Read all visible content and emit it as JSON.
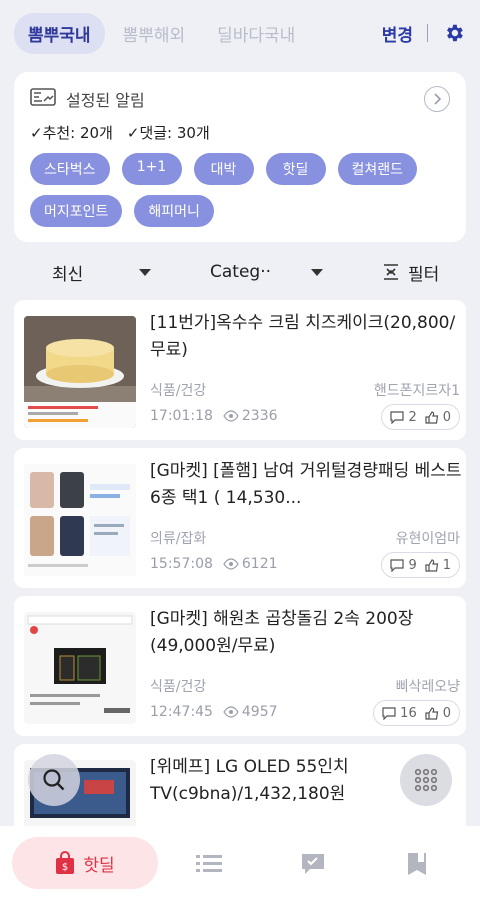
{
  "topbar": {
    "tabs": [
      {
        "label": "뽐뿌국내"
      },
      {
        "label": "뽐뿌해외"
      },
      {
        "label": "딜바다국내"
      }
    ],
    "change_label": "변경"
  },
  "alerts": {
    "title": "설정된 알림",
    "recommend": "✓추천: 20개",
    "comments": "✓댓글: 30개",
    "keywords": [
      "스타벅스",
      "1+1",
      "대박",
      "핫딜",
      "컬쳐랜드",
      "머지포인트",
      "해피머니"
    ]
  },
  "filters": {
    "sort": "최신",
    "category": "Categ··",
    "filter_label": "필터"
  },
  "deals": [
    {
      "title": "[11번가]옥수수 크림 치즈케이크(20,800/무료)",
      "category": "식품/건강",
      "author": "핸드폰지르자1",
      "time": "17:01:18",
      "views": "2336",
      "comments": "2",
      "likes": "0"
    },
    {
      "title": "[G마켓] [폴햄] 남여 거위털경량패딩 베스트 6종 택1 ( 14,530...",
      "category": "의류/잡화",
      "author": "유현이엄마",
      "time": "15:57:08",
      "views": "6121",
      "comments": "9",
      "likes": "1"
    },
    {
      "title": "[G마켓] 해원초 곱창돌김 2속 200장 (49,000원/무료)",
      "category": "식품/건강",
      "author": "삐삭레오냥",
      "time": "12:47:45",
      "views": "4957",
      "comments": "16",
      "likes": "0"
    },
    {
      "title": "[위메프] LG OLED 55인치 TV(c9bna)/1,432,180원",
      "category": "",
      "author": "",
      "time": "",
      "views": "",
      "comments": "",
      "likes": ""
    }
  ],
  "bottomnav": {
    "active_label": "핫딜"
  },
  "colors": {
    "accent": "#2b3aa6",
    "chip": "#8891df",
    "hot": "#e03045"
  }
}
